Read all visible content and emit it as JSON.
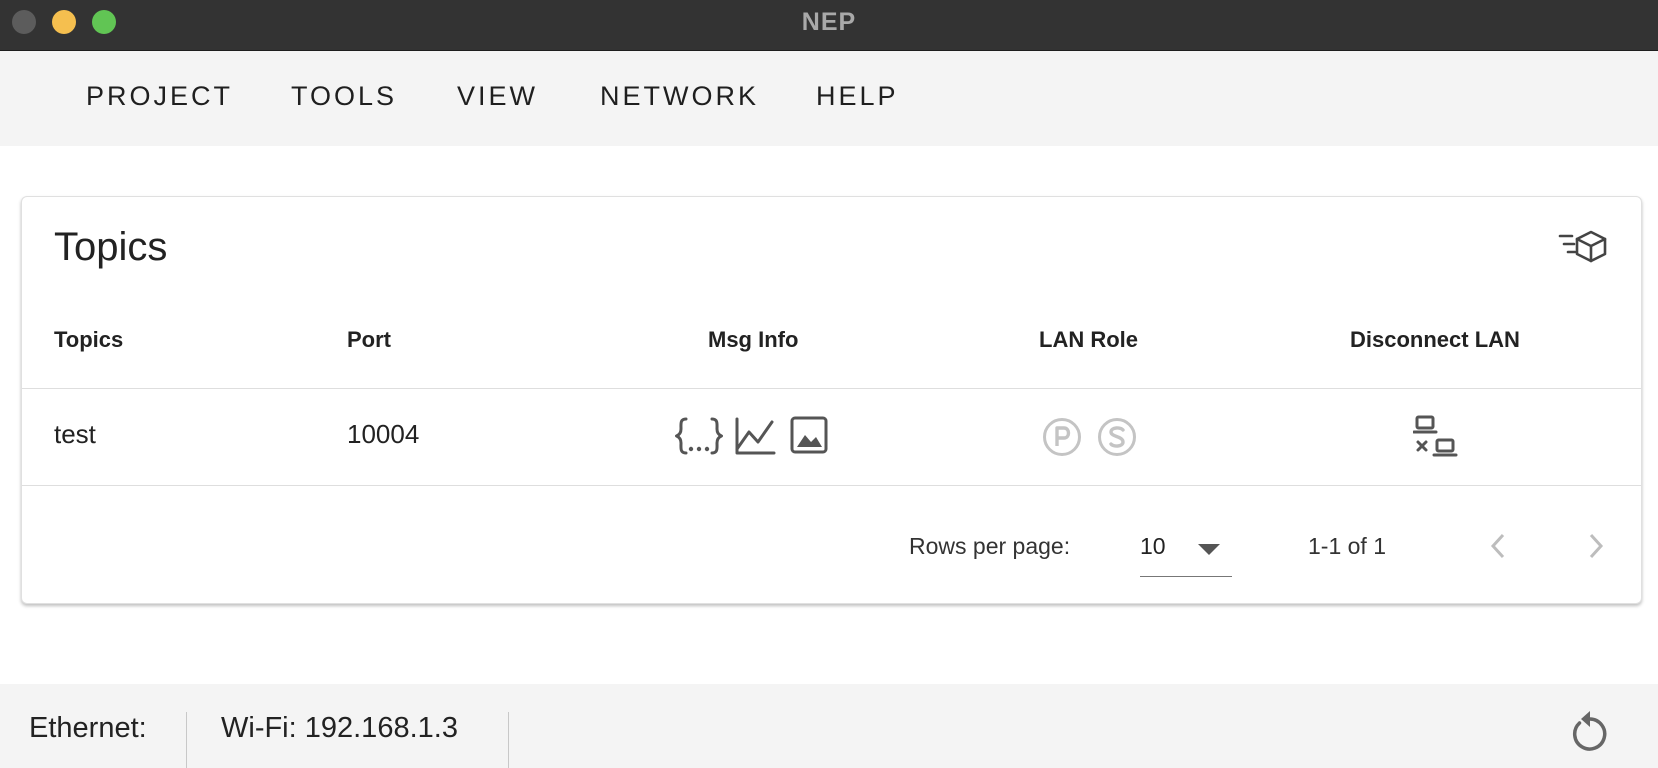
{
  "window": {
    "title": "NEP"
  },
  "menu": {
    "items": [
      {
        "label": "PROJECT"
      },
      {
        "label": "TOOLS"
      },
      {
        "label": "VIEW"
      },
      {
        "label": "NETWORK"
      },
      {
        "label": "HELP"
      }
    ]
  },
  "topics_card": {
    "title": "Topics",
    "action_icon": "filter-cube-icon",
    "columns": [
      "Topics",
      "Port",
      "Msg Info",
      "LAN Role",
      "Disconnect LAN"
    ],
    "rows": [
      {
        "topic": "test",
        "port": "10004",
        "msg_info_icons": [
          "json-braces-icon",
          "line-chart-icon",
          "image-icon"
        ],
        "lan_role_icons": [
          "publisher-p-icon",
          "subscriber-s-icon"
        ],
        "disconnect_icon": "lan-disconnect-icon"
      }
    ],
    "pagination": {
      "rows_per_page_label": "Rows per page:",
      "rows_per_page_value": "10",
      "range_text": "1-1 of 1"
    }
  },
  "status": {
    "ethernet": "Ethernet:",
    "wifi": "Wi-Fi: 192.168.1.3",
    "refresh_icon": "refresh-icon"
  },
  "colors": {
    "titlebar": "#333333",
    "menubar": "#f4f4f4",
    "disabled_icon": "#c4c4c4",
    "icon": "#555555"
  }
}
